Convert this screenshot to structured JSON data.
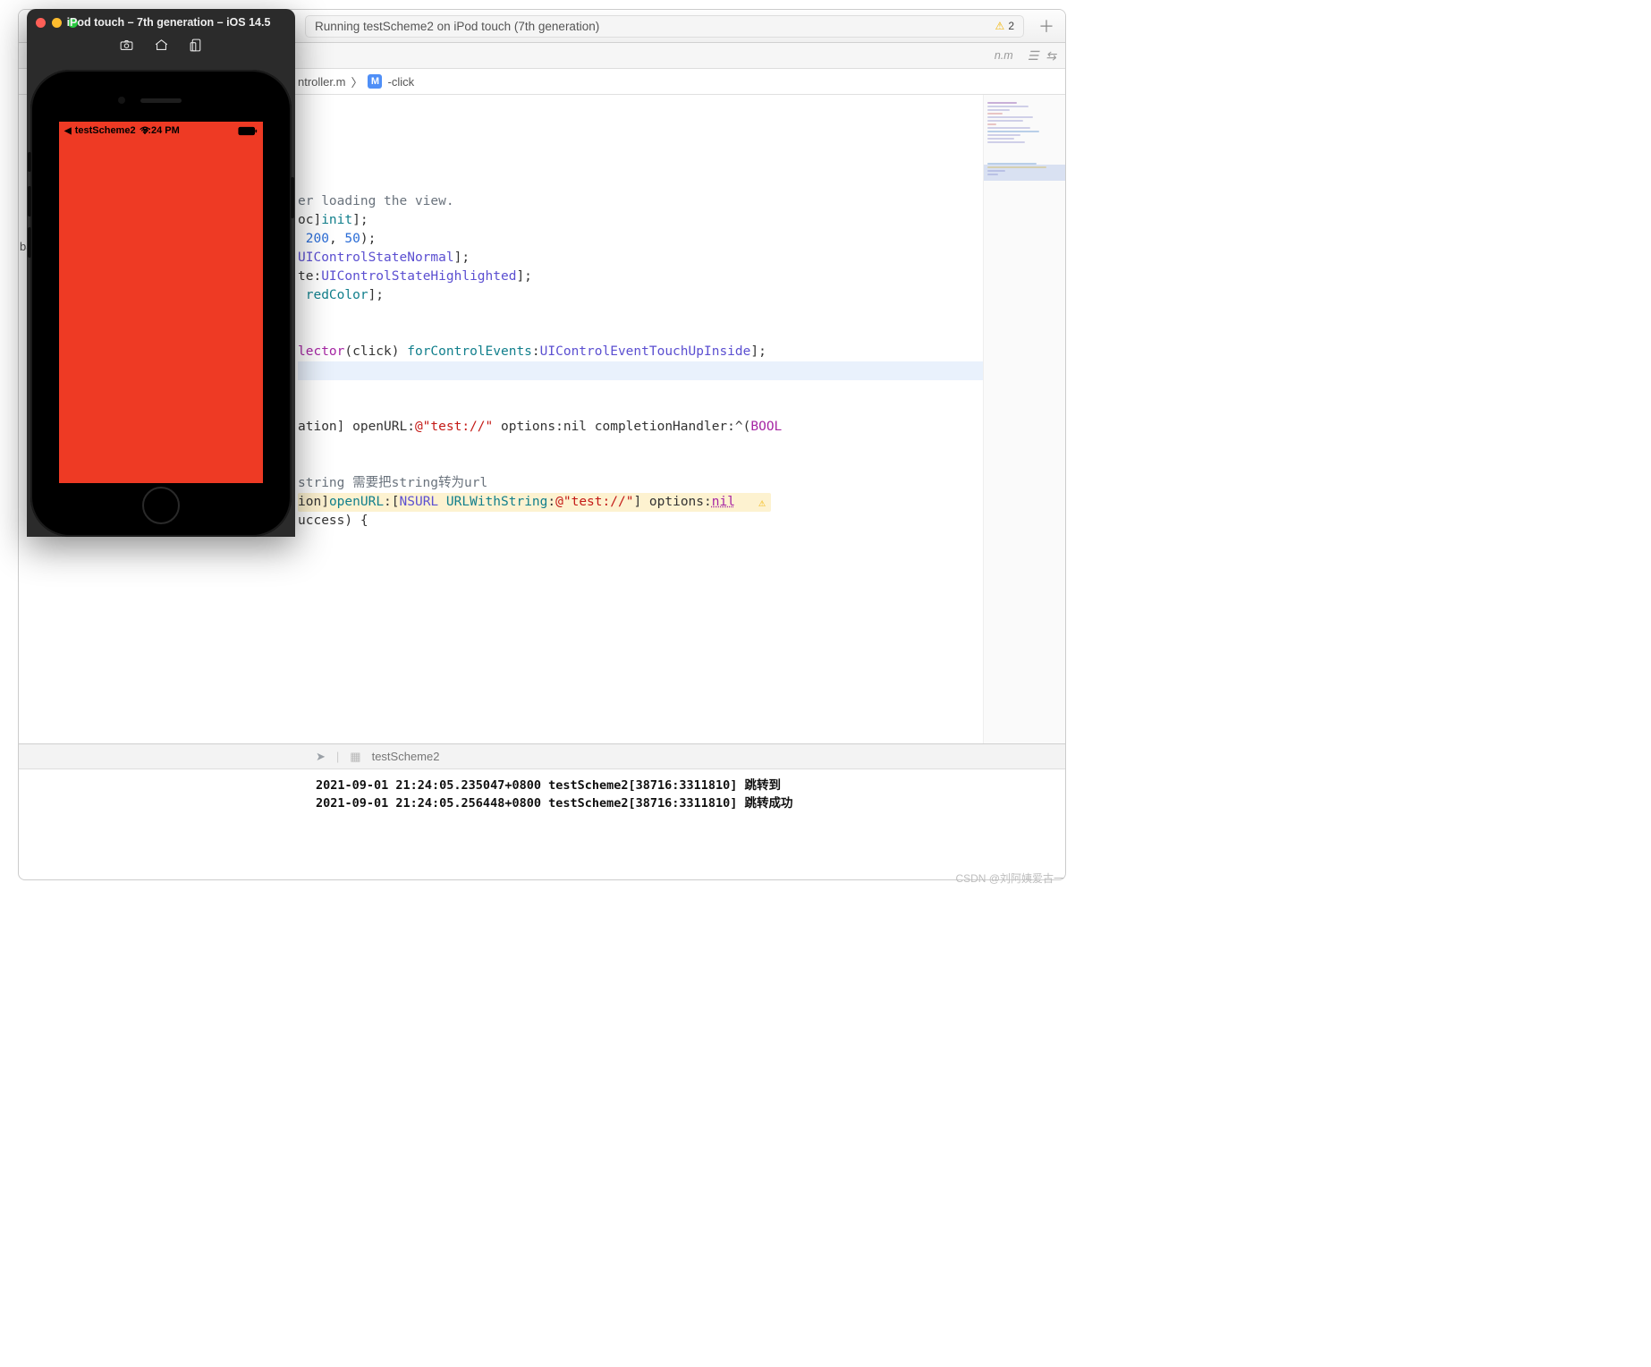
{
  "xcode": {
    "status_text": "Running testScheme2 on iPod touch (7th generation)",
    "warning_count": "2",
    "tab_hint": "n.m",
    "breadcrumb_file": "ntroller.m",
    "breadcrumb_symbol": "-click",
    "sidebar_peek": "ba"
  },
  "code": {
    "l1": "er loading the view.",
    "l2a": "oc]",
    "l2b": "init",
    "l2c": "];",
    "l3a": " ",
    "l3b": "200",
    "l3c": ", ",
    "l3d": "50",
    "l3e": ");",
    "l4a": "UIControlStateNormal",
    "l4b": "];",
    "l5a": "te:",
    "l5b": "UIControlStateHighlighted",
    "l5c": "];",
    "l6a": " ",
    "l6b": "redColor",
    "l6c": "];",
    "l7a": "lector",
    "l7b": "(click) ",
    "l7c": "forControlEvents",
    "l7d": ":",
    "l7e": "UIControlEventTouchUpInside",
    "l7f": "];",
    "l8a": "ation] openURL:",
    "l8b": "@\"test://\"",
    "l8c": " options:nil completionHandler:^(",
    "l8d": "BOOL",
    "l9a": "string 需要把string转为url",
    "l10a": "ion",
    "l10b": "]",
    "l10c": "openURL",
    "l10d": ":[",
    "l10e": "NSURL",
    "l10f": " ",
    "l10g": "URLWithString",
    "l10h": ":",
    "l10i": "@\"test://\"",
    "l10j": "] options:",
    "l10k": "nil",
    "l11a": "uccess) {"
  },
  "console": {
    "target": "testScheme2",
    "line1": "2021-09-01 21:24:05.235047+0800 testScheme2[38716:3311810] 跳转到",
    "line2": "2021-09-01 21:24:05.256448+0800 testScheme2[38716:3311810] 跳转成功"
  },
  "simulator": {
    "title": "iPod touch – 7th generation – iOS 14.5",
    "back_app": "testScheme2",
    "clock": "9:24 PM"
  },
  "watermark": "CSDN @刘阿姨爱古一"
}
